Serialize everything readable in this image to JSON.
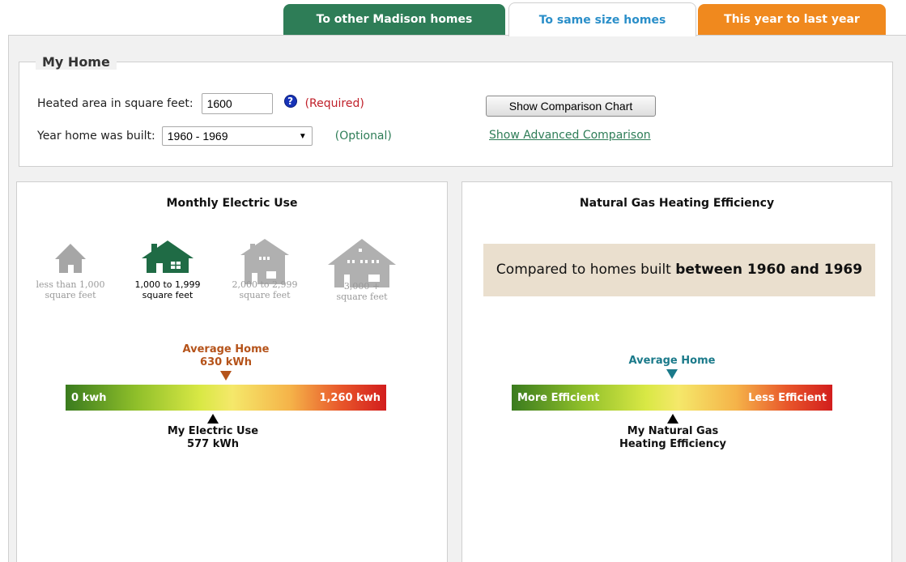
{
  "tabs": [
    {
      "label": "To other Madison homes",
      "color": "#2e7d57"
    },
    {
      "label": "To same size homes",
      "color": "#2b8fc9",
      "active": true
    },
    {
      "label": "This year to last year",
      "color": "#f0891e"
    }
  ],
  "my_home": {
    "legend": "My Home",
    "sqft_label": "Heated area in square feet:",
    "sqft_value": "1600",
    "required_label": "(Required)",
    "year_label": "Year home was built:",
    "year_selected": "1960 - 1969",
    "optional_label": "(Optional)",
    "compare_button": "Show Comparison Chart",
    "advanced_link": "Show Advanced Comparison"
  },
  "electric": {
    "title": "Monthly Electric Use",
    "house_sizes": [
      {
        "line1": "less than 1,000",
        "line2": "square feet",
        "selected": false,
        "icon": "small-house-icon"
      },
      {
        "line1": "1,000 to 1,999",
        "line2": "square feet",
        "selected": true,
        "icon": "medium-house-icon"
      },
      {
        "line1": "2,000 to 2,999",
        "line2": "square feet",
        "selected": false,
        "icon": "large-house-icon"
      },
      {
        "line1": "3,000 +",
        "line2": "square feet",
        "selected": false,
        "icon": "xlarge-house-icon"
      }
    ],
    "average_label": "Average Home",
    "average_value": "630 kWh",
    "gauge_min": "0 kwh",
    "gauge_max": "1,260 kwh",
    "my_label": "My Electric Use",
    "my_value": "577 kWh",
    "average_color": "#b5531a"
  },
  "gas": {
    "title": "Natural Gas Heating Efficiency",
    "compare_prefix": "Compared to homes built ",
    "compare_bold": "between 1960 and 1969",
    "average_label": "Average Home",
    "gauge_left": "More Efficient",
    "gauge_right": "Less Efficient",
    "my_label_line1": "My Natural Gas",
    "my_label_line2": "Heating Efficiency",
    "average_color": "#1b7a8a"
  }
}
